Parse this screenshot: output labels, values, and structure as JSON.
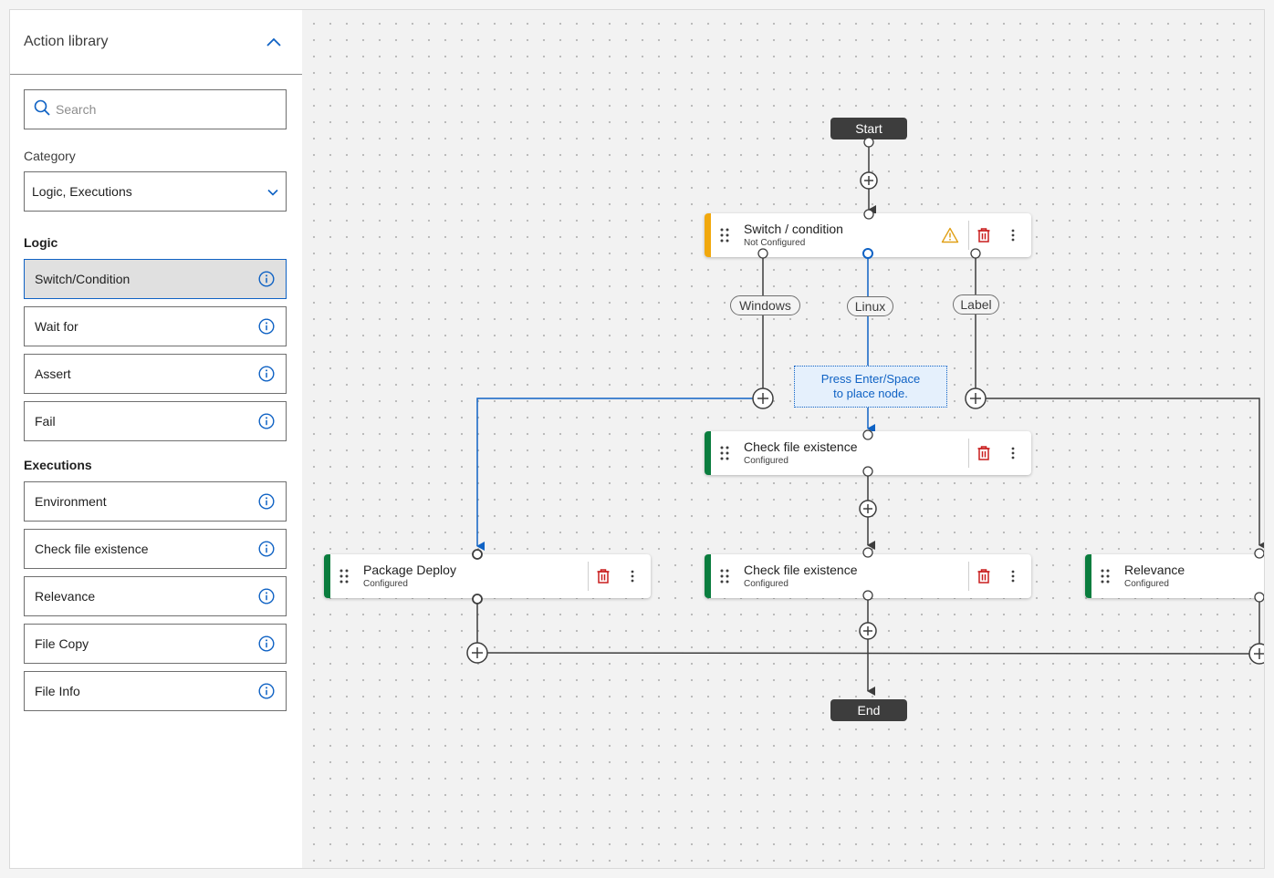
{
  "sidebar": {
    "title": "Action library",
    "search_placeholder": "Search",
    "category_label": "Category",
    "category_value": "Logic, Executions",
    "sections": {
      "logic": {
        "title": "Logic",
        "items": [
          "Switch/Condition",
          "Wait for",
          "Assert",
          "Fail"
        ]
      },
      "executions": {
        "title": "Executions",
        "items": [
          "Environment",
          "Check file existence",
          "Relevance",
          "File Copy",
          "File Info"
        ]
      }
    },
    "selected_item": "Switch/Condition"
  },
  "canvas": {
    "start_label": "Start",
    "end_label": "End",
    "hint_line1": "Press Enter/Space",
    "hint_line2": "to place node.",
    "branch_labels": [
      "Windows",
      "Linux",
      "Label"
    ],
    "nodes": {
      "switch": {
        "title": "Switch / condition",
        "status": "Not Configured"
      },
      "check1": {
        "title": "Check file existence",
        "status": "Configured"
      },
      "package": {
        "title": "Package Deploy",
        "status": "Configured"
      },
      "check2": {
        "title": "Check file existence",
        "status": "Configured"
      },
      "relevance": {
        "title": "Relevance",
        "status": "Configured"
      }
    }
  },
  "colors": {
    "accent_blue": "#0f62c4",
    "warning_yellow": "#f1a80d",
    "configured_green": "#0a7d3e",
    "delete_red": "#c91d1d",
    "terminal_dark": "#3d3d3d"
  }
}
